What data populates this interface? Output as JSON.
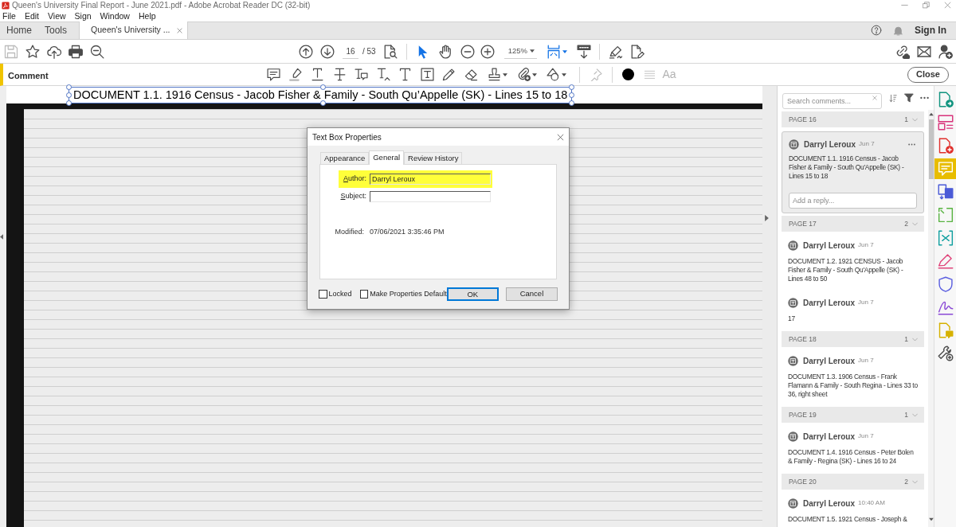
{
  "window": {
    "title": "Queen's University Final Report - June 2021.pdf - Adobe Acrobat Reader DC (32-bit)"
  },
  "menu": [
    "File",
    "Edit",
    "View",
    "Sign",
    "Window",
    "Help"
  ],
  "tabs": [
    {
      "label": "Home",
      "selected": false,
      "closable": false
    },
    {
      "label": "Tools",
      "selected": false,
      "closable": false
    },
    {
      "label": "Queen's University ...",
      "selected": true,
      "closable": true
    }
  ],
  "account": {
    "sign_in": "Sign In"
  },
  "toolbar": {
    "save_disabled": true,
    "page": "16",
    "page_total": "/ 53",
    "modes": [
      {
        "kind": "select",
        "selected": true
      },
      {
        "kind": "hand",
        "selected": false
      }
    ],
    "zoom": "125%"
  },
  "comment_bar": {
    "title": "Comment",
    "pin_disabled": true,
    "line_style_disabled": true,
    "font_label": "Aa",
    "font_disabled": true,
    "close": "Close"
  },
  "document": {
    "heading": "DOCUMENT 1.1. 1916 Census - Jacob Fisher & Family - South Qu’Appelle (SK) - Lines 15 to 18",
    "heading_selected": true
  },
  "dialog": {
    "title": "Text Box Properties",
    "tabs": [
      {
        "label": "Appearance",
        "selected": false
      },
      {
        "label": "General",
        "selected": true
      },
      {
        "label": "Review History",
        "selected": false
      }
    ],
    "fields": [
      {
        "label": "Author:",
        "value": "Darryl Leroux",
        "highlighted": true
      },
      {
        "label": "Subject:",
        "highlighted": false
      }
    ],
    "modified": {
      "label": "Modified:",
      "value": "07/06/2021 3:35:46 PM"
    },
    "checkboxes": [
      {
        "label": "Locked",
        "checked": false
      },
      {
        "label": "Make Properties Default",
        "checked": false
      }
    ],
    "buttons": [
      {
        "label": "OK",
        "focused": true
      },
      {
        "label": "Cancel",
        "focused": false
      }
    ]
  },
  "comments_panel": {
    "search_placeholder": "Search comments...",
    "groups": [
      {
        "page": "PAGE 16",
        "count": "1",
        "expanded": true,
        "comments": [
          {
            "author": "Darryl Leroux",
            "date": "Jun 7",
            "text": "DOCUMENT 1.1. 1916 Census - Jacob Fisher & Family - South Qu'Appelle (SK) - Lines 15 to 18",
            "selected": true,
            "reply_placeholder": "Add a reply..."
          }
        ]
      },
      {
        "page": "PAGE 17",
        "count": "2",
        "expanded": true,
        "comments": [
          {
            "author": "Darryl Leroux",
            "date": "Jun 7",
            "text": "DOCUMENT 1.2. 1921 CENSUS - Jacob Fisher & Family - South Qu'Appelle (SK) - Lines 48 to 50",
            "selected": false
          },
          {
            "author": "Darryl Leroux",
            "date": "Jun 7",
            "text": "17",
            "selected": false
          }
        ]
      },
      {
        "page": "PAGE 18",
        "count": "1",
        "expanded": true,
        "comments": [
          {
            "author": "Darryl Leroux",
            "date": "Jun 7",
            "text": "DOCUMENT 1.3. 1906 Census - Frank Flamann & Family - South Regina - Lines 33 to 36, right sheet",
            "selected": false
          }
        ]
      },
      {
        "page": "PAGE 19",
        "count": "1",
        "expanded": true,
        "comments": [
          {
            "author": "Darryl Leroux",
            "date": "Jun 7",
            "text": "DOCUMENT 1.4. 1916 Census - Peter Bolen & Family - Regina (SK) - Lines 16 to 24",
            "selected": false
          }
        ]
      },
      {
        "page": "PAGE 20",
        "count": "2",
        "expanded": true,
        "comments": [
          {
            "author": "Darryl Leroux",
            "date": "10:40 AM",
            "text": "DOCUMENT 1.5. 1921 Census - Joseph &",
            "selected": false
          }
        ]
      }
    ]
  },
  "tools_sidebar": [
    {
      "kind": "export-pdf",
      "selected": false
    },
    {
      "kind": "organize-pages",
      "selected": false
    },
    {
      "kind": "create-pdf",
      "selected": false
    },
    {
      "kind": "comment",
      "selected": true
    },
    {
      "kind": "combine",
      "selected": false
    },
    {
      "kind": "scan",
      "selected": false
    },
    {
      "kind": "compress",
      "selected": false
    },
    {
      "kind": "fill-sign",
      "selected": false
    },
    {
      "kind": "protect",
      "selected": false
    },
    {
      "kind": "request-signature",
      "selected": false
    },
    {
      "kind": "send-comments",
      "selected": false
    },
    {
      "kind": "more-tools",
      "selected": false
    }
  ]
}
